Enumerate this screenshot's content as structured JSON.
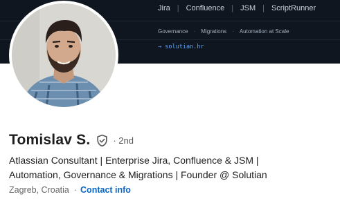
{
  "banner": {
    "products": [
      "Jira",
      "Confluence",
      "JSM",
      "ScriptRunner"
    ],
    "product_separator": "|",
    "tags": [
      "Governance",
      "Migrations",
      "Automation at Scale"
    ],
    "tag_separator": "·",
    "url": "→ solutian.hr",
    "background_color": "#10161f",
    "url_color": "#5aa3ff"
  },
  "profile": {
    "name": "Tomislav S.",
    "verified_icon": "verified-shield-icon",
    "degree": "· 2nd",
    "headline_line1": "Atlassian Consultant | Enterprise Jira, Confluence & JSM |",
    "headline_line2": "Automation, Governance & Migrations | Founder @ Solutian",
    "location": "Zagreb, Croatia",
    "meta_separator": "·",
    "contact_label": "Contact info",
    "link_color": "#0a66c2"
  }
}
